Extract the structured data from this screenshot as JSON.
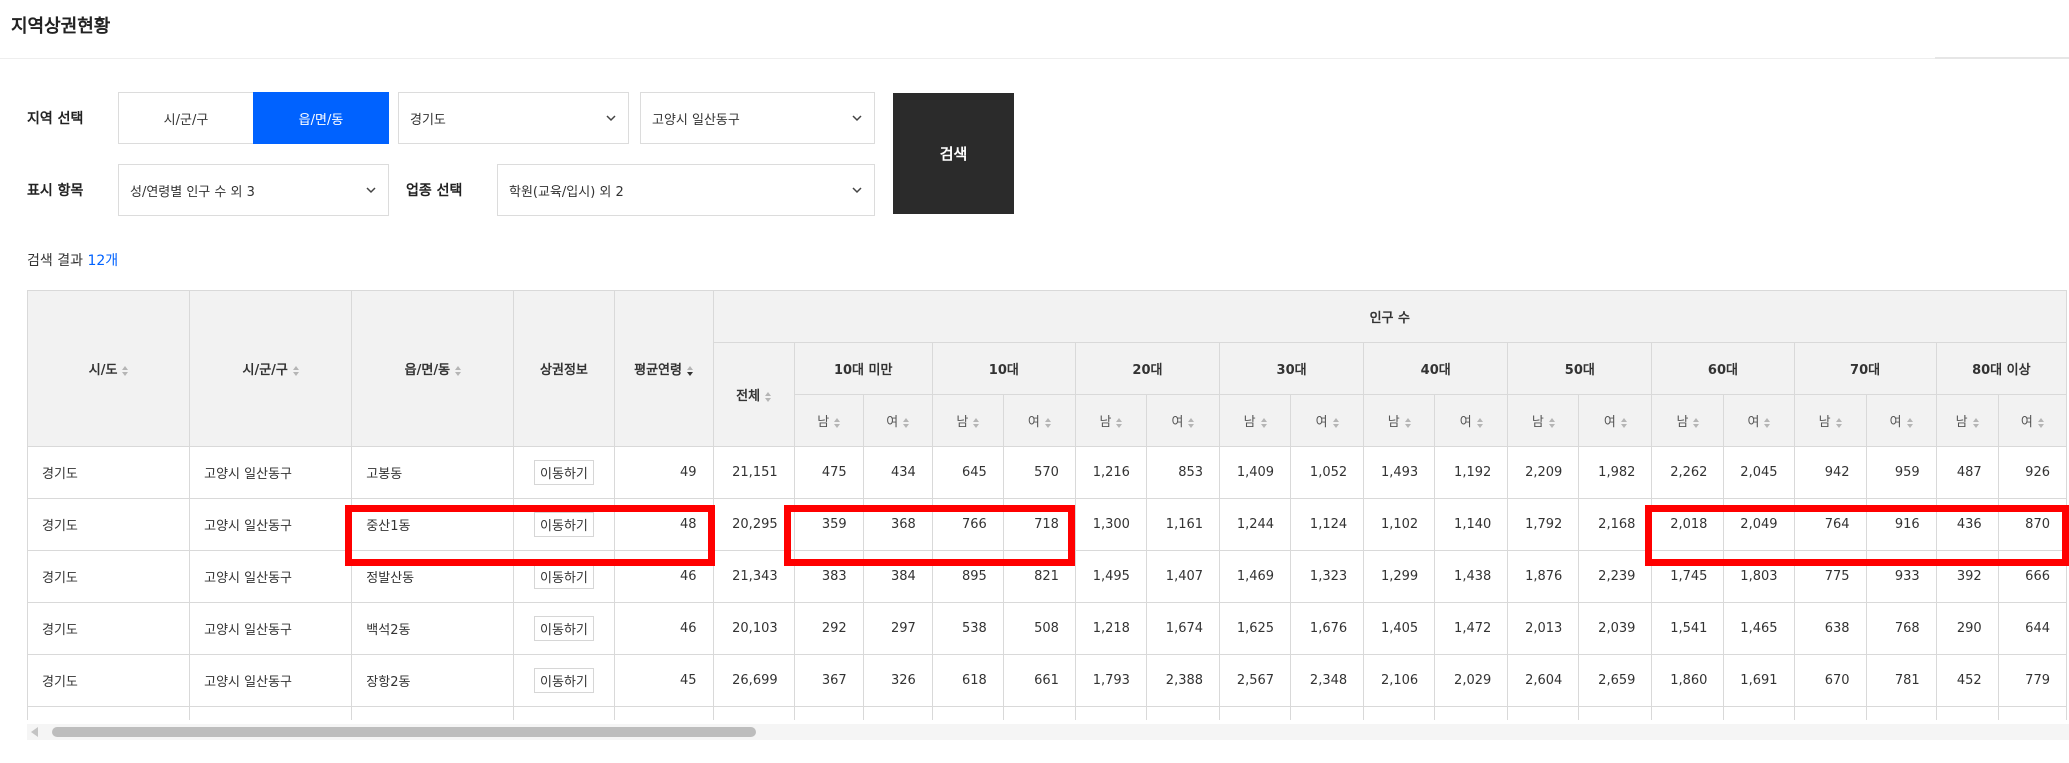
{
  "page": {
    "title": "지역상권현황"
  },
  "filters": {
    "region_label": "지역 선택",
    "seg_sigungu": "시/군/구",
    "seg_eupmyeon": "읍/면/동",
    "province": "경기도",
    "city": "고양시 일산동구",
    "display_label": "표시 항목",
    "display_value": "성/연령별 인구 수 외 3",
    "industry_label": "업종 선택",
    "industry_value": "학원(교육/입시) 외 2",
    "search_button": "검색"
  },
  "result": {
    "prefix": "검색 결과",
    "count": "12개"
  },
  "table": {
    "headers": {
      "sido": "시/도",
      "sigungu": "시/군/구",
      "eupmyeon": "읍/면/동",
      "info": "상권정보",
      "avg_age": "평균연령",
      "population": "인구 수",
      "total": "전체",
      "male": "남",
      "female": "여",
      "age_groups": [
        "10대 미만",
        "10대",
        "20대",
        "30대",
        "40대",
        "50대",
        "60대",
        "70대",
        "80대 이상"
      ]
    },
    "move_label": "이동하기",
    "rows": [
      {
        "sido": "경기도",
        "sigungu": "고양시 일산동구",
        "dong": "고봉동",
        "avg": "49",
        "total": "21,151",
        "vals": [
          "475",
          "434",
          "645",
          "570",
          "1,216",
          "853",
          "1,409",
          "1,052",
          "1,493",
          "1,192",
          "2,209",
          "1,982",
          "2,262",
          "2,045",
          "942",
          "959",
          "487",
          "926"
        ]
      },
      {
        "sido": "경기도",
        "sigungu": "고양시 일산동구",
        "dong": "중산1동",
        "avg": "48",
        "total": "20,295",
        "vals": [
          "359",
          "368",
          "766",
          "718",
          "1,300",
          "1,161",
          "1,244",
          "1,124",
          "1,102",
          "1,140",
          "1,792",
          "2,168",
          "2,018",
          "2,049",
          "764",
          "916",
          "436",
          "870"
        ]
      },
      {
        "sido": "경기도",
        "sigungu": "고양시 일산동구",
        "dong": "정발산동",
        "avg": "46",
        "total": "21,343",
        "vals": [
          "383",
          "384",
          "895",
          "821",
          "1,495",
          "1,407",
          "1,469",
          "1,323",
          "1,299",
          "1,438",
          "1,876",
          "2,239",
          "1,745",
          "1,803",
          "775",
          "933",
          "392",
          "666"
        ]
      },
      {
        "sido": "경기도",
        "sigungu": "고양시 일산동구",
        "dong": "백석2동",
        "avg": "46",
        "total": "20,103",
        "vals": [
          "292",
          "297",
          "538",
          "508",
          "1,218",
          "1,674",
          "1,625",
          "1,676",
          "1,405",
          "1,472",
          "2,013",
          "2,039",
          "1,541",
          "1,465",
          "638",
          "768",
          "290",
          "644"
        ]
      },
      {
        "sido": "경기도",
        "sigungu": "고양시 일산동구",
        "dong": "장항2동",
        "avg": "45",
        "total": "26,699",
        "vals": [
          "367",
          "326",
          "618",
          "661",
          "1,793",
          "2,388",
          "2,567",
          "2,348",
          "2,106",
          "2,029",
          "2,604",
          "2,659",
          "1,860",
          "1,691",
          "670",
          "781",
          "452",
          "779"
        ]
      }
    ]
  }
}
